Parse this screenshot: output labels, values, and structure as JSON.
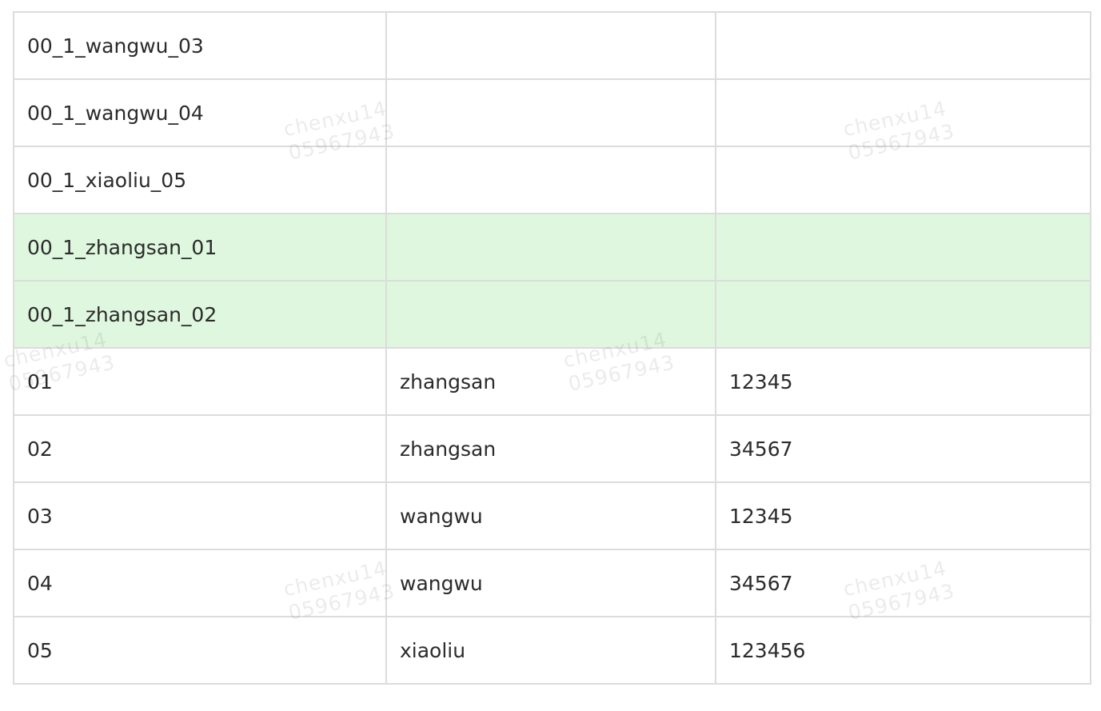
{
  "table": {
    "rows": [
      {
        "cells": [
          "00_1_wangwu_03",
          "",
          ""
        ],
        "highlighted": false
      },
      {
        "cells": [
          "00_1_wangwu_04",
          "",
          ""
        ],
        "highlighted": false
      },
      {
        "cells": [
          "00_1_xiaoliu_05",
          "",
          ""
        ],
        "highlighted": false
      },
      {
        "cells": [
          "00_1_zhangsan_01",
          "",
          ""
        ],
        "highlighted": true
      },
      {
        "cells": [
          "00_1_zhangsan_02",
          "",
          ""
        ],
        "highlighted": true
      },
      {
        "cells": [
          "01",
          "zhangsan",
          "12345"
        ],
        "highlighted": false
      },
      {
        "cells": [
          "02",
          "zhangsan",
          "34567"
        ],
        "highlighted": false
      },
      {
        "cells": [
          "03",
          "wangwu",
          "12345"
        ],
        "highlighted": false
      },
      {
        "cells": [
          "04",
          "wangwu",
          "34567"
        ],
        "highlighted": false
      },
      {
        "cells": [
          "05",
          "xiaoliu",
          "123456"
        ],
        "highlighted": false
      }
    ],
    "highlight_color": "#dff7df",
    "border_color": "#dcdcdc"
  },
  "watermark": {
    "line1": "chenxu14",
    "line2": "05967943"
  }
}
